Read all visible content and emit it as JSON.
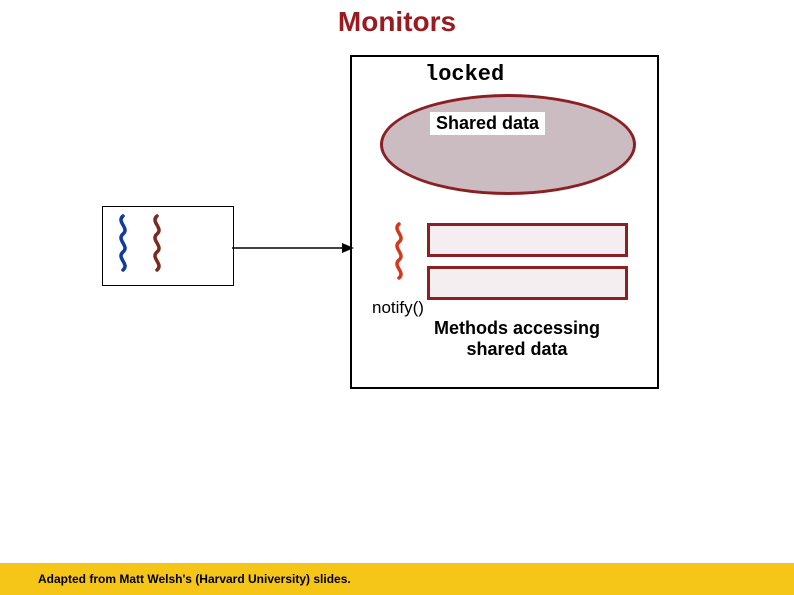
{
  "title": "Monitors",
  "locked_label": "locked",
  "shared_data_label": "Shared data",
  "notify_label": "notify()",
  "methods_label_line1": "Methods accessing",
  "methods_label_line2": "shared data",
  "footer": "Adapted from Matt Welsh's (Harvard University) slides.",
  "threads": {
    "waiting": [
      "blue-thread",
      "darkred-thread"
    ],
    "active": [
      "red-thread"
    ]
  },
  "colors": {
    "title": "#991b1f",
    "monitor_border": "#000000",
    "ellipse_fill": "#cbbcc2",
    "ellipse_border": "#8a1f24",
    "method_fill": "#f4eef1",
    "method_border": "#8a1f24",
    "footer_bg": "#f5c518"
  }
}
